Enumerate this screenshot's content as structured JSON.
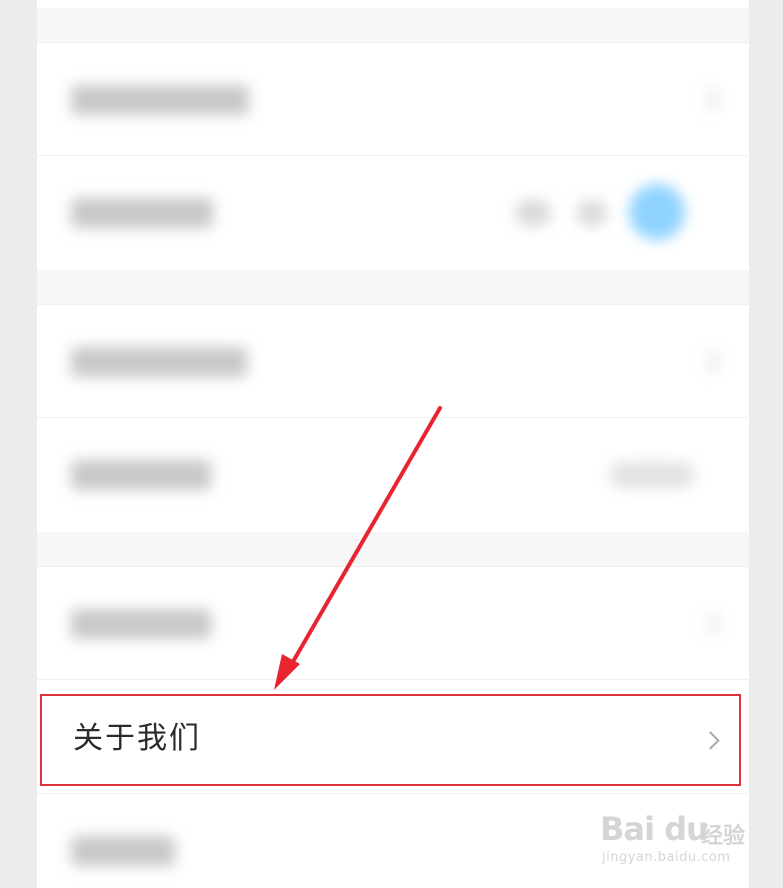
{
  "settings": {
    "about_us_label": "关于我们"
  },
  "watermark": {
    "brand": "Bai du",
    "suffix": "经验",
    "url": "jingyan.baidu.com"
  },
  "colors": {
    "highlight": "#e0323c",
    "toggle_accent": "#8fd3ff",
    "background": "#f7f7f7"
  },
  "icons": {
    "chevron": "chevron-right-icon",
    "paw": "baidu-paw-icon"
  }
}
